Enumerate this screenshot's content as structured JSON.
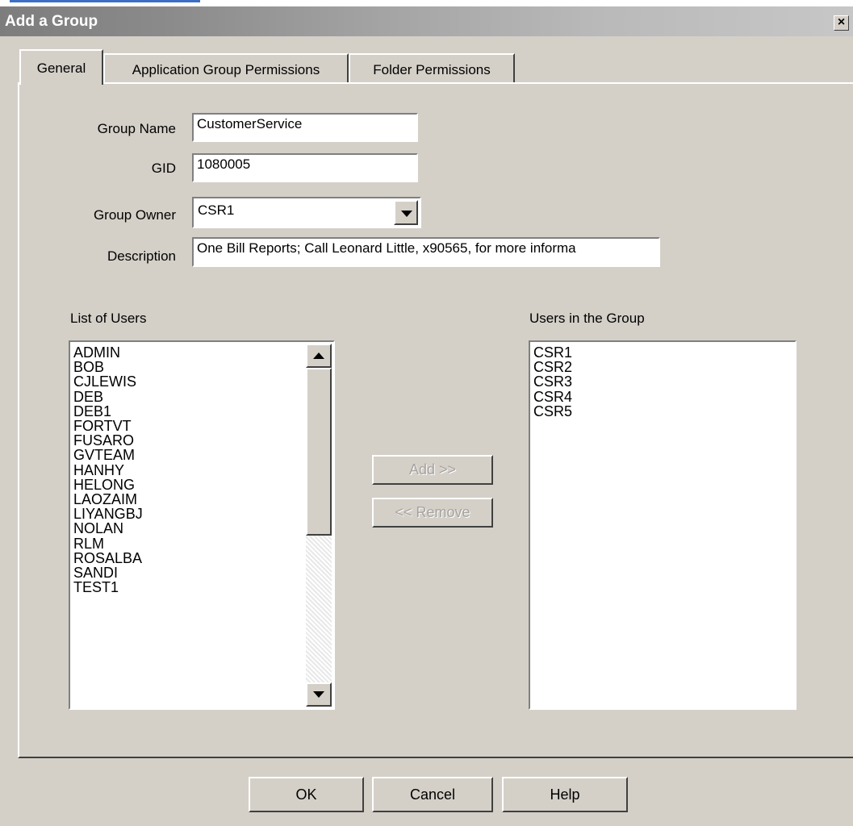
{
  "window": {
    "title": "Add a Group",
    "close_label": "×"
  },
  "tabs": [
    {
      "label": "General",
      "active": true
    },
    {
      "label": "Application Group Permissions",
      "active": false
    },
    {
      "label": "Folder Permissions",
      "active": false
    }
  ],
  "form": {
    "group_name": {
      "label": "Group Name",
      "value": "CustomerService"
    },
    "gid": {
      "label": "GID",
      "value": "1080005"
    },
    "group_owner": {
      "label": "Group Owner",
      "value": "CSR1"
    },
    "description": {
      "label": "Description",
      "value": "One Bill Reports; Call Leonard Little, x90565, for more informa"
    }
  },
  "list_of_users": {
    "label": "List of Users",
    "items": [
      "ADMIN",
      "BOB",
      "CJLEWIS",
      "DEB",
      "DEB1",
      "FORTVT",
      "FUSARO",
      "GVTEAM",
      "HANHY",
      "HELONG",
      "LAOZAIM",
      "LIYANGBJ",
      "NOLAN",
      "RLM",
      "ROSALBA",
      "SANDI",
      "TEST1"
    ]
  },
  "users_in_group": {
    "label": "Users in the Group",
    "items": [
      "CSR1",
      "CSR2",
      "CSR3",
      "CSR4",
      "CSR5"
    ]
  },
  "transfer": {
    "add_label": "Add >>",
    "remove_label": "<< Remove"
  },
  "footer": {
    "ok_label": "OK",
    "cancel_label": "Cancel",
    "help_label": "Help"
  }
}
